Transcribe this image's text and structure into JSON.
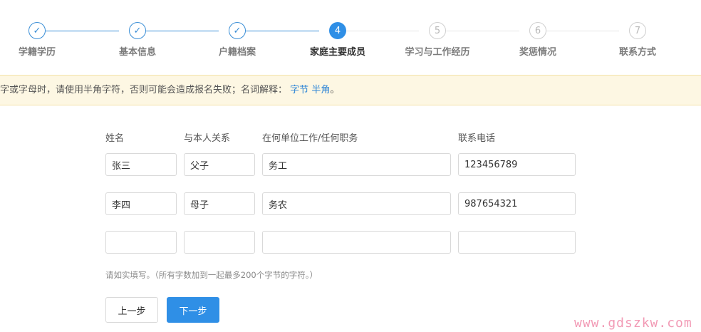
{
  "steps": [
    {
      "number": "1",
      "label": "学籍学历",
      "state": "done"
    },
    {
      "number": "2",
      "label": "基本信息",
      "state": "done"
    },
    {
      "number": "3",
      "label": "户籍档案",
      "state": "done"
    },
    {
      "number": "4",
      "label": "家庭主要成员",
      "state": "active"
    },
    {
      "number": "5",
      "label": "学习与工作经历",
      "state": "todo"
    },
    {
      "number": "6",
      "label": "奖惩情况",
      "state": "todo"
    },
    {
      "number": "7",
      "label": "联系方式",
      "state": "todo"
    }
  ],
  "notice": {
    "text": "字或字母时，请使用半角字符，否则可能会造成报名失败；名词解释：",
    "link_byte": "字节",
    "link_halfwidth": "半角",
    "suffix": "。"
  },
  "form": {
    "headers": {
      "name": "姓名",
      "relation": "与本人关系",
      "workplace": "在何单位工作/任何职务",
      "phone": "联系电话"
    },
    "rows": [
      {
        "name": "张三",
        "relation": "父子",
        "workplace": "务工",
        "phone": "123456789"
      },
      {
        "name": "李四",
        "relation": "母子",
        "workplace": "务农",
        "phone": "987654321"
      },
      {
        "name": "",
        "relation": "",
        "workplace": "",
        "phone": ""
      }
    ],
    "hint": "请如实填写。（所有字数加到一起最多200个字节的字符。）"
  },
  "buttons": {
    "prev": "上一步",
    "next": "下一步"
  },
  "watermark": "www.gdszkw.com",
  "colors": {
    "accent": "#2f8fe6",
    "notice_bg": "#fdf7e3",
    "watermark": "#f29ab5"
  }
}
